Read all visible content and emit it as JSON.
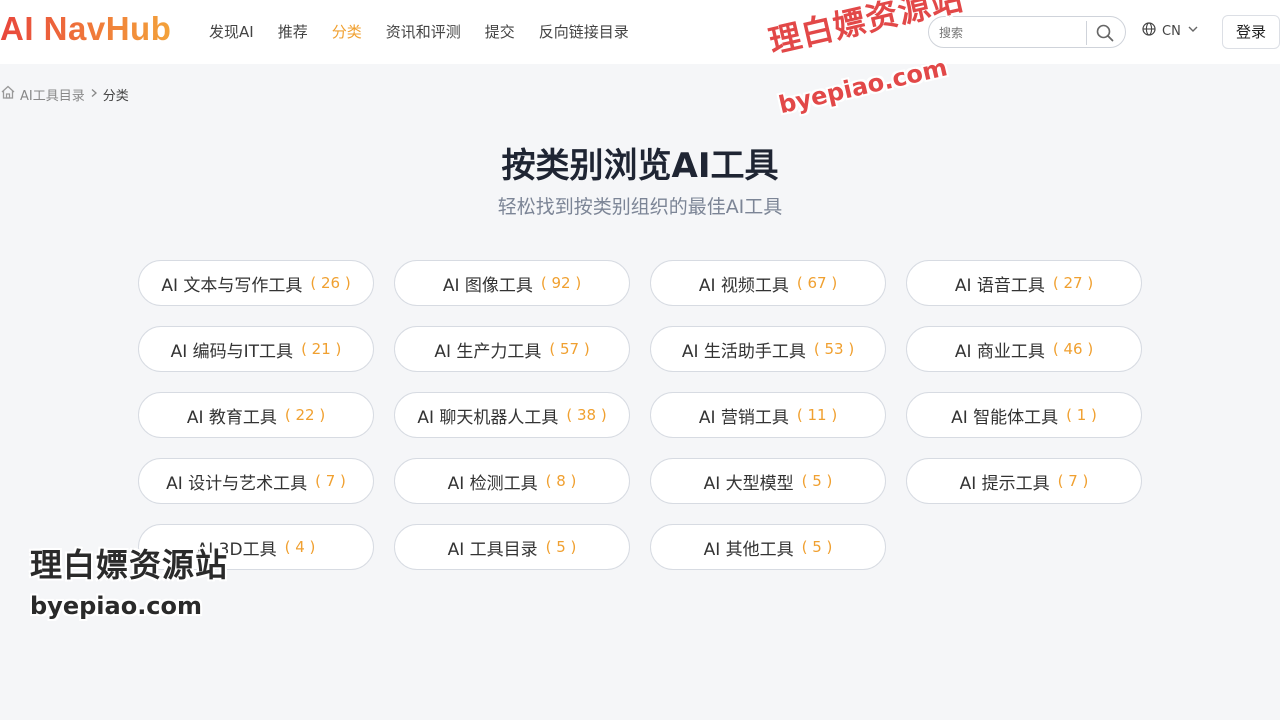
{
  "header": {
    "logo": "AI NavHub",
    "nav": [
      {
        "label": "发现AI",
        "active": false
      },
      {
        "label": "推荐",
        "active": false
      },
      {
        "label": "分类",
        "active": true
      },
      {
        "label": "资讯和评测",
        "active": false
      },
      {
        "label": "提交",
        "active": false
      },
      {
        "label": "反向链接目录",
        "active": false
      }
    ],
    "search": {
      "placeholder": "搜索",
      "icon": "search-icon"
    },
    "language": {
      "label": "CN",
      "icon": "globe-icon"
    },
    "login_label": "登录"
  },
  "breadcrumb": {
    "home_label": "AI工具目录",
    "current": "分类"
  },
  "main": {
    "title": "按类别浏览AI工具",
    "subtitle": "轻松找到按类别组织的最佳AI工具"
  },
  "categories": [
    {
      "name": "AI 文本与写作工具",
      "count": "( 26 )"
    },
    {
      "name": "AI 图像工具",
      "count": "( 92 )"
    },
    {
      "name": "AI 视频工具",
      "count": "( 67 )"
    },
    {
      "name": "AI 语音工具",
      "count": "( 27 )"
    },
    {
      "name": "AI 编码与IT工具",
      "count": "( 21 )"
    },
    {
      "name": "AI 生产力工具",
      "count": "( 57 )"
    },
    {
      "name": "AI 生活助手工具",
      "count": "( 53 )"
    },
    {
      "name": "AI 商业工具",
      "count": "( 46 )"
    },
    {
      "name": "AI 教育工具",
      "count": "( 22 )"
    },
    {
      "name": "AI 聊天机器人工具",
      "count": "( 38 )"
    },
    {
      "name": "AI 营销工具",
      "count": "( 11 )"
    },
    {
      "name": "AI 智能体工具",
      "count": "( 1 )"
    },
    {
      "name": "AI 设计与艺术工具",
      "count": "( 7 )"
    },
    {
      "name": "AI 检测工具",
      "count": "( 8 )"
    },
    {
      "name": "AI 大型模型",
      "count": "( 5 )"
    },
    {
      "name": "AI 提示工具",
      "count": "( 7 )"
    },
    {
      "name": "AI 3D工具",
      "count": "( 4 )"
    },
    {
      "name": "AI 工具目录",
      "count": "( 5 )"
    },
    {
      "name": "AI 其他工具",
      "count": "( 5 )"
    }
  ],
  "watermarks": {
    "site_name": "理白嫖资源站",
    "site_url": "byepiao.com"
  },
  "colors": {
    "accent": "#f0a030",
    "logo_start": "#e8453c",
    "logo_end": "#f3a23a",
    "watermark_red": "#e24848"
  }
}
